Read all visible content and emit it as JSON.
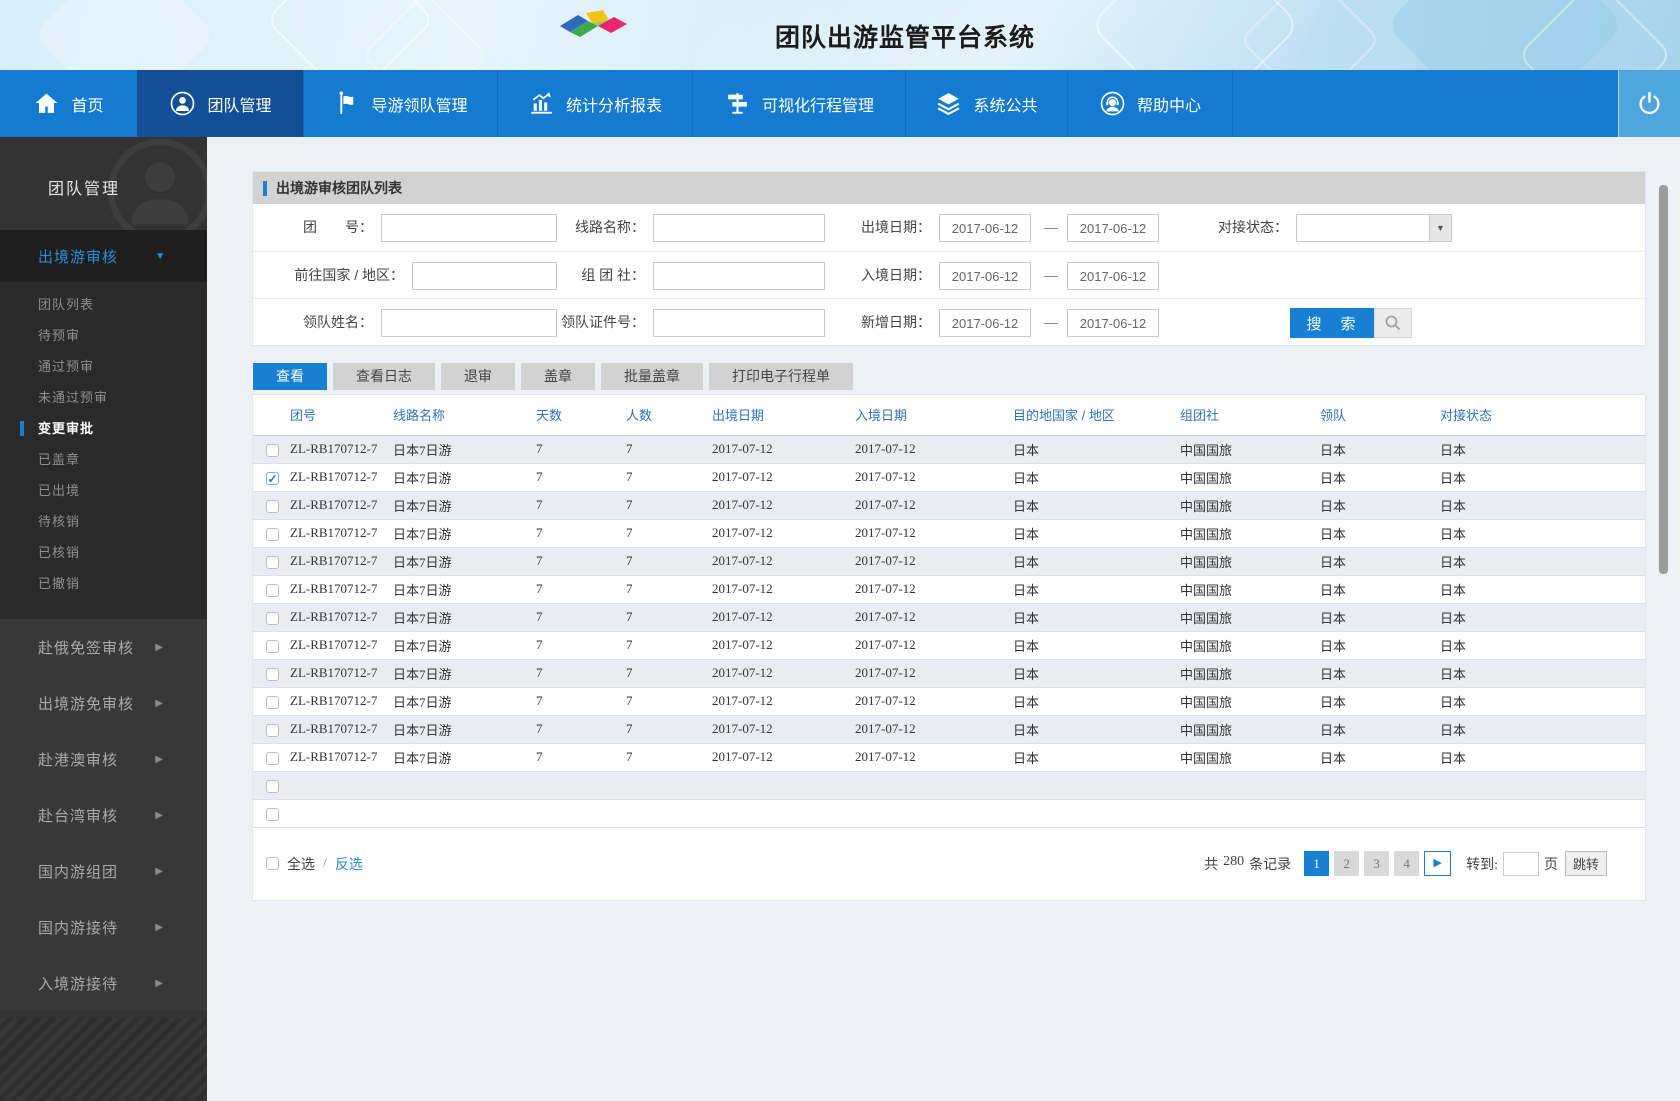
{
  "app": {
    "title": "团队出游监管平台系统"
  },
  "colors": {
    "nav_blue": "#147bd1",
    "nav_active_blue": "#134f97",
    "accent_blue": "#1780d3",
    "link_blue": "#2a8fd8",
    "sidebar_bg": "#333333",
    "row_stripe": "#e9edf3",
    "panel_header_gray": "#d2d2d2"
  },
  "nav": {
    "items": [
      {
        "label": "首页",
        "icon": "home-icon",
        "active": false
      },
      {
        "label": "团队管理",
        "icon": "team-icon",
        "active": true
      },
      {
        "label": "导游领队管理",
        "icon": "flag-icon",
        "active": false
      },
      {
        "label": "统计分析报表",
        "icon": "chart-icon",
        "active": false
      },
      {
        "label": "可视化行程管理",
        "icon": "signpost-icon",
        "active": false
      },
      {
        "label": "系统公共",
        "icon": "layers-icon",
        "active": false
      },
      {
        "label": "帮助中心",
        "icon": "headset-icon",
        "active": false
      }
    ],
    "logout_icon": "power-icon"
  },
  "sidebar": {
    "title": "团队管理",
    "group": {
      "label": "出境游审核",
      "expanded": true,
      "items": [
        {
          "label": "团队列表",
          "active": false
        },
        {
          "label": "待预审",
          "active": false
        },
        {
          "label": "通过预审",
          "active": false
        },
        {
          "label": "未通过预审",
          "active": false
        },
        {
          "label": "变更审批",
          "active": true
        },
        {
          "label": "已盖章",
          "active": false
        },
        {
          "label": "已出境",
          "active": false
        },
        {
          "label": "待核销",
          "active": false
        },
        {
          "label": "已核销",
          "active": false
        },
        {
          "label": "已撤销",
          "active": false
        }
      ]
    },
    "groups": [
      {
        "label": "赴俄免签审核"
      },
      {
        "label": "出境游免审核"
      },
      {
        "label": "赴港澳审核"
      },
      {
        "label": "赴台湾审核"
      },
      {
        "label": "国内游组团"
      },
      {
        "label": "国内游接待"
      },
      {
        "label": "入境游接待"
      }
    ]
  },
  "search": {
    "title": "出境游审核团队列表",
    "labels": {
      "group_no": "团　　号：",
      "route_name": "线路名称：",
      "depart_date": "出境日期：",
      "status": "对接状态：",
      "dest_country": "前往国家 / 地区：",
      "agency": "组 团 社：",
      "entry_date": "入境日期：",
      "leader_name": "领队姓名：",
      "leader_id": "领队证件号：",
      "added_date": "新增日期："
    },
    "dash": "—",
    "values": {
      "depart_from": "2017-06-12",
      "depart_to": "2017-06-12",
      "entry_from": "2017-06-12",
      "entry_to": "2017-06-12",
      "added_from": "2017-06-12",
      "added_to": "2017-06-12",
      "status_selected": ""
    },
    "button": "搜　索"
  },
  "tabs": [
    {
      "label": "查看",
      "active": true
    },
    {
      "label": "查看日志",
      "active": false
    },
    {
      "label": "退审",
      "active": false
    },
    {
      "label": "盖章",
      "active": false
    },
    {
      "label": "批量盖章",
      "active": false
    },
    {
      "label": "打印电子行程单",
      "active": false
    }
  ],
  "table": {
    "columns": [
      "团号",
      "线路名称",
      "天数",
      "人数",
      "出境日期",
      "入境日期",
      "目的地国家 / 地区",
      "组团社",
      "领队",
      "对接状态"
    ],
    "rows": [
      {
        "checked": false,
        "cells": [
          "ZL-RB170712-7",
          "日本7日游",
          "7",
          "7",
          "2017-07-12",
          "2017-07-12",
          "日本",
          "中国国旅",
          "日本",
          "日本"
        ]
      },
      {
        "checked": true,
        "cells": [
          "ZL-RB170712-7",
          "日本7日游",
          "7",
          "7",
          "2017-07-12",
          "2017-07-12",
          "日本",
          "中国国旅",
          "日本",
          "日本"
        ]
      },
      {
        "checked": false,
        "cells": [
          "ZL-RB170712-7",
          "日本7日游",
          "7",
          "7",
          "2017-07-12",
          "2017-07-12",
          "日本",
          "中国国旅",
          "日本",
          "日本"
        ]
      },
      {
        "checked": false,
        "cells": [
          "ZL-RB170712-7",
          "日本7日游",
          "7",
          "7",
          "2017-07-12",
          "2017-07-12",
          "日本",
          "中国国旅",
          "日本",
          "日本"
        ]
      },
      {
        "checked": false,
        "cells": [
          "ZL-RB170712-7",
          "日本7日游",
          "7",
          "7",
          "2017-07-12",
          "2017-07-12",
          "日本",
          "中国国旅",
          "日本",
          "日本"
        ]
      },
      {
        "checked": false,
        "cells": [
          "ZL-RB170712-7",
          "日本7日游",
          "7",
          "7",
          "2017-07-12",
          "2017-07-12",
          "日本",
          "中国国旅",
          "日本",
          "日本"
        ]
      },
      {
        "checked": false,
        "cells": [
          "ZL-RB170712-7",
          "日本7日游",
          "7",
          "7",
          "2017-07-12",
          "2017-07-12",
          "日本",
          "中国国旅",
          "日本",
          "日本"
        ]
      },
      {
        "checked": false,
        "cells": [
          "ZL-RB170712-7",
          "日本7日游",
          "7",
          "7",
          "2017-07-12",
          "2017-07-12",
          "日本",
          "中国国旅",
          "日本",
          "日本"
        ]
      },
      {
        "checked": false,
        "cells": [
          "ZL-RB170712-7",
          "日本7日游",
          "7",
          "7",
          "2017-07-12",
          "2017-07-12",
          "日本",
          "中国国旅",
          "日本",
          "日本"
        ]
      },
      {
        "checked": false,
        "cells": [
          "ZL-RB170712-7",
          "日本7日游",
          "7",
          "7",
          "2017-07-12",
          "2017-07-12",
          "日本",
          "中国国旅",
          "日本",
          "日本"
        ]
      },
      {
        "checked": false,
        "cells": [
          "ZL-RB170712-7",
          "日本7日游",
          "7",
          "7",
          "2017-07-12",
          "2017-07-12",
          "日本",
          "中国国旅",
          "日本",
          "日本"
        ]
      },
      {
        "checked": false,
        "cells": [
          "ZL-RB170712-7",
          "日本7日游",
          "7",
          "7",
          "2017-07-12",
          "2017-07-12",
          "日本",
          "中国国旅",
          "日本",
          "日本"
        ]
      },
      {
        "checked": false,
        "cells": [
          "",
          "",
          "",
          "",
          "",
          "",
          "",
          "",
          "",
          ""
        ]
      },
      {
        "checked": false,
        "cells": [
          "",
          "",
          "",
          "",
          "",
          "",
          "",
          "",
          "",
          ""
        ]
      }
    ]
  },
  "footer": {
    "select_all": "全选",
    "slash": "/",
    "invert_select": "反选",
    "total_prefix": "共",
    "total_count": "280",
    "total_suffix": "条记录",
    "pages": [
      "1",
      "2",
      "3",
      "4"
    ],
    "current_page": "1",
    "next_icon": "play-arrow-icon",
    "goto_label": "转到:",
    "page_unit": "页",
    "jump_button": "跳转"
  }
}
